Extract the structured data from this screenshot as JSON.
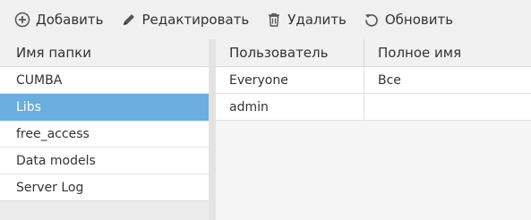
{
  "toolbar": {
    "add_label": "Добавить",
    "edit_label": "Редактировать",
    "delete_label": "Удалить",
    "refresh_label": "Обновить"
  },
  "folders": {
    "header": "Имя папки",
    "items": [
      {
        "name": "CUMBA",
        "selected": false
      },
      {
        "name": "Libs",
        "selected": true
      },
      {
        "name": "free_access",
        "selected": false
      },
      {
        "name": "Data models",
        "selected": false
      },
      {
        "name": "Server Log",
        "selected": false
      }
    ]
  },
  "users": {
    "columns": [
      "Пользователь",
      "Полное имя"
    ],
    "rows": [
      {
        "user": "Everyone",
        "full_name": "Все"
      },
      {
        "user": "admin",
        "full_name": ""
      }
    ]
  },
  "colors": {
    "selection": "#6aaee0",
    "toolbar_bg": "#f0f0f0",
    "icon": "#555555"
  }
}
